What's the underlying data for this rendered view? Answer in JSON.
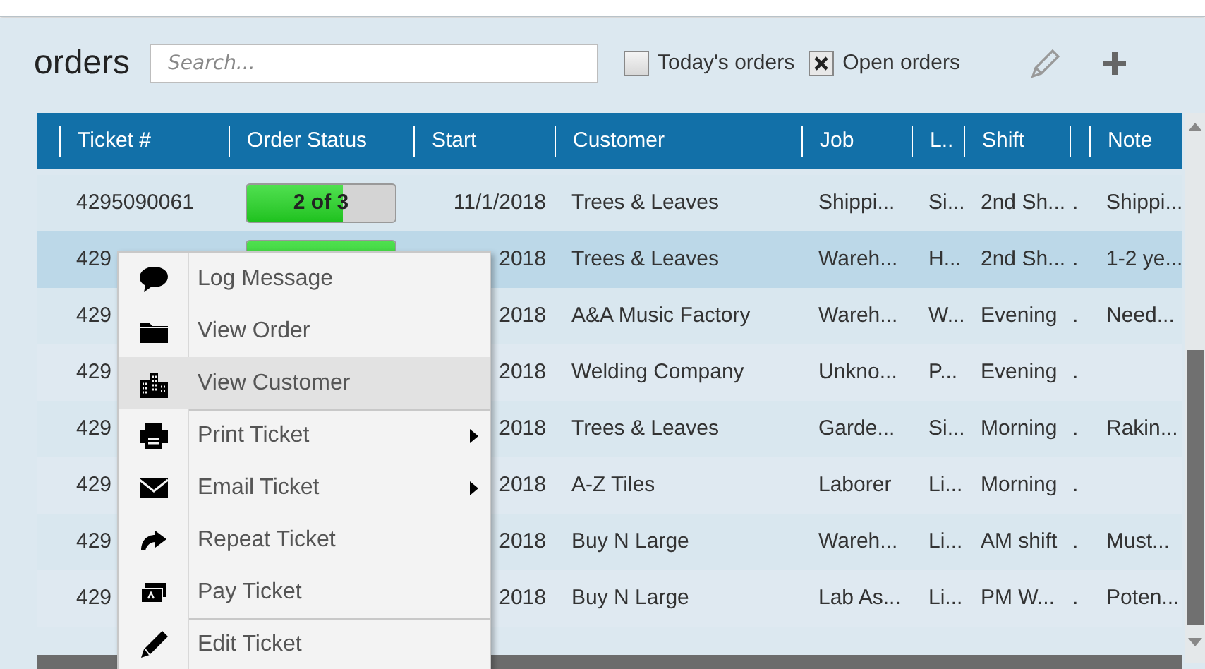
{
  "title": "orders",
  "search": {
    "placeholder": "Search..."
  },
  "filters": [
    {
      "label": "Today's orders",
      "checked": false
    },
    {
      "label": "Open orders",
      "checked": true
    }
  ],
  "table": {
    "columns": [
      "Ticket #",
      "Order Status",
      "Start",
      "Customer",
      "Job",
      "L..",
      "Shift",
      "",
      "Note"
    ],
    "rows": [
      {
        "ticket": "4295090061",
        "status": {
          "text": "2 of 3",
          "level": 0.65
        },
        "start": "11/1/2018",
        "customer": "Trees & Leaves",
        "job": "Shippi...",
        "column_7": "Si...",
        "shift": "2nd Sh...",
        "column_9": ".",
        "note": "Shippi...",
        "selected": false
      },
      {
        "ticket": "429",
        "status": {
          "level": 1
        },
        "start": "2018",
        "customer": "Trees & Leaves",
        "job": "Wareh...",
        "column_7": "H...",
        "shift": "2nd Sh...",
        "column_9": ".",
        "note": "1-2 ye...",
        "selected": true
      },
      {
        "ticket": "429",
        "start": "2018",
        "customer": "A&A Music Factory",
        "job": "Wareh...",
        "column_7": "W...",
        "shift": "Evening",
        "column_9": ".",
        "note": "Need...",
        "selected": false
      },
      {
        "ticket": "429",
        "start": "2018",
        "customer": "Welding Company",
        "job": "Unkno...",
        "column_7": "P...",
        "shift": "Evening",
        "column_9": ".",
        "selected": false
      },
      {
        "ticket": "429",
        "start": "2018",
        "customer": "Trees & Leaves",
        "job": "Garde...",
        "column_7": "Si...",
        "shift": "Morning",
        "column_9": ".",
        "note": "Rakin...",
        "selected": false
      },
      {
        "ticket": "429",
        "start": "2018",
        "customer": "A-Z Tiles",
        "job": "Laborer",
        "column_7": "Li...",
        "shift": "Morning",
        "column_9": ".",
        "selected": false
      },
      {
        "ticket": "429",
        "start": "2018",
        "customer": "Buy N Large",
        "job": "Wareh...",
        "column_7": "Li...",
        "shift": "AM shift",
        "column_9": ".",
        "note": "Must...",
        "selected": false
      },
      {
        "ticket": "429",
        "start": "2018",
        "customer": "Buy N Large",
        "job": "Lab As...",
        "column_7": "Li...",
        "shift": "PM W...",
        "column_9": ".",
        "note": "Poten...",
        "selected": false
      }
    ]
  },
  "context_menu": [
    {
      "label": "Log Message",
      "kind": "speech",
      "submenu": false,
      "selected": false,
      "separator_before": false
    },
    {
      "label": "View Order",
      "kind": "folder",
      "submenu": false,
      "selected": false,
      "separator_before": false
    },
    {
      "label": "View Customer",
      "kind": "buildings",
      "submenu": false,
      "selected": true,
      "separator_before": false
    },
    {
      "label": "Print Ticket",
      "kind": "printer",
      "submenu": true,
      "selected": false,
      "separator_before": true
    },
    {
      "label": "Email Ticket",
      "kind": "envelope",
      "submenu": true,
      "selected": false,
      "separator_before": false
    },
    {
      "label": "Repeat Ticket",
      "kind": "repeat",
      "submenu": false,
      "selected": false,
      "separator_before": false
    },
    {
      "label": "Pay Ticket",
      "kind": "cash",
      "submenu": false,
      "selected": false,
      "separator_before": false
    },
    {
      "label": "Edit Ticket",
      "kind": "pencil",
      "submenu": false,
      "selected": false,
      "separator_before": true
    }
  ]
}
